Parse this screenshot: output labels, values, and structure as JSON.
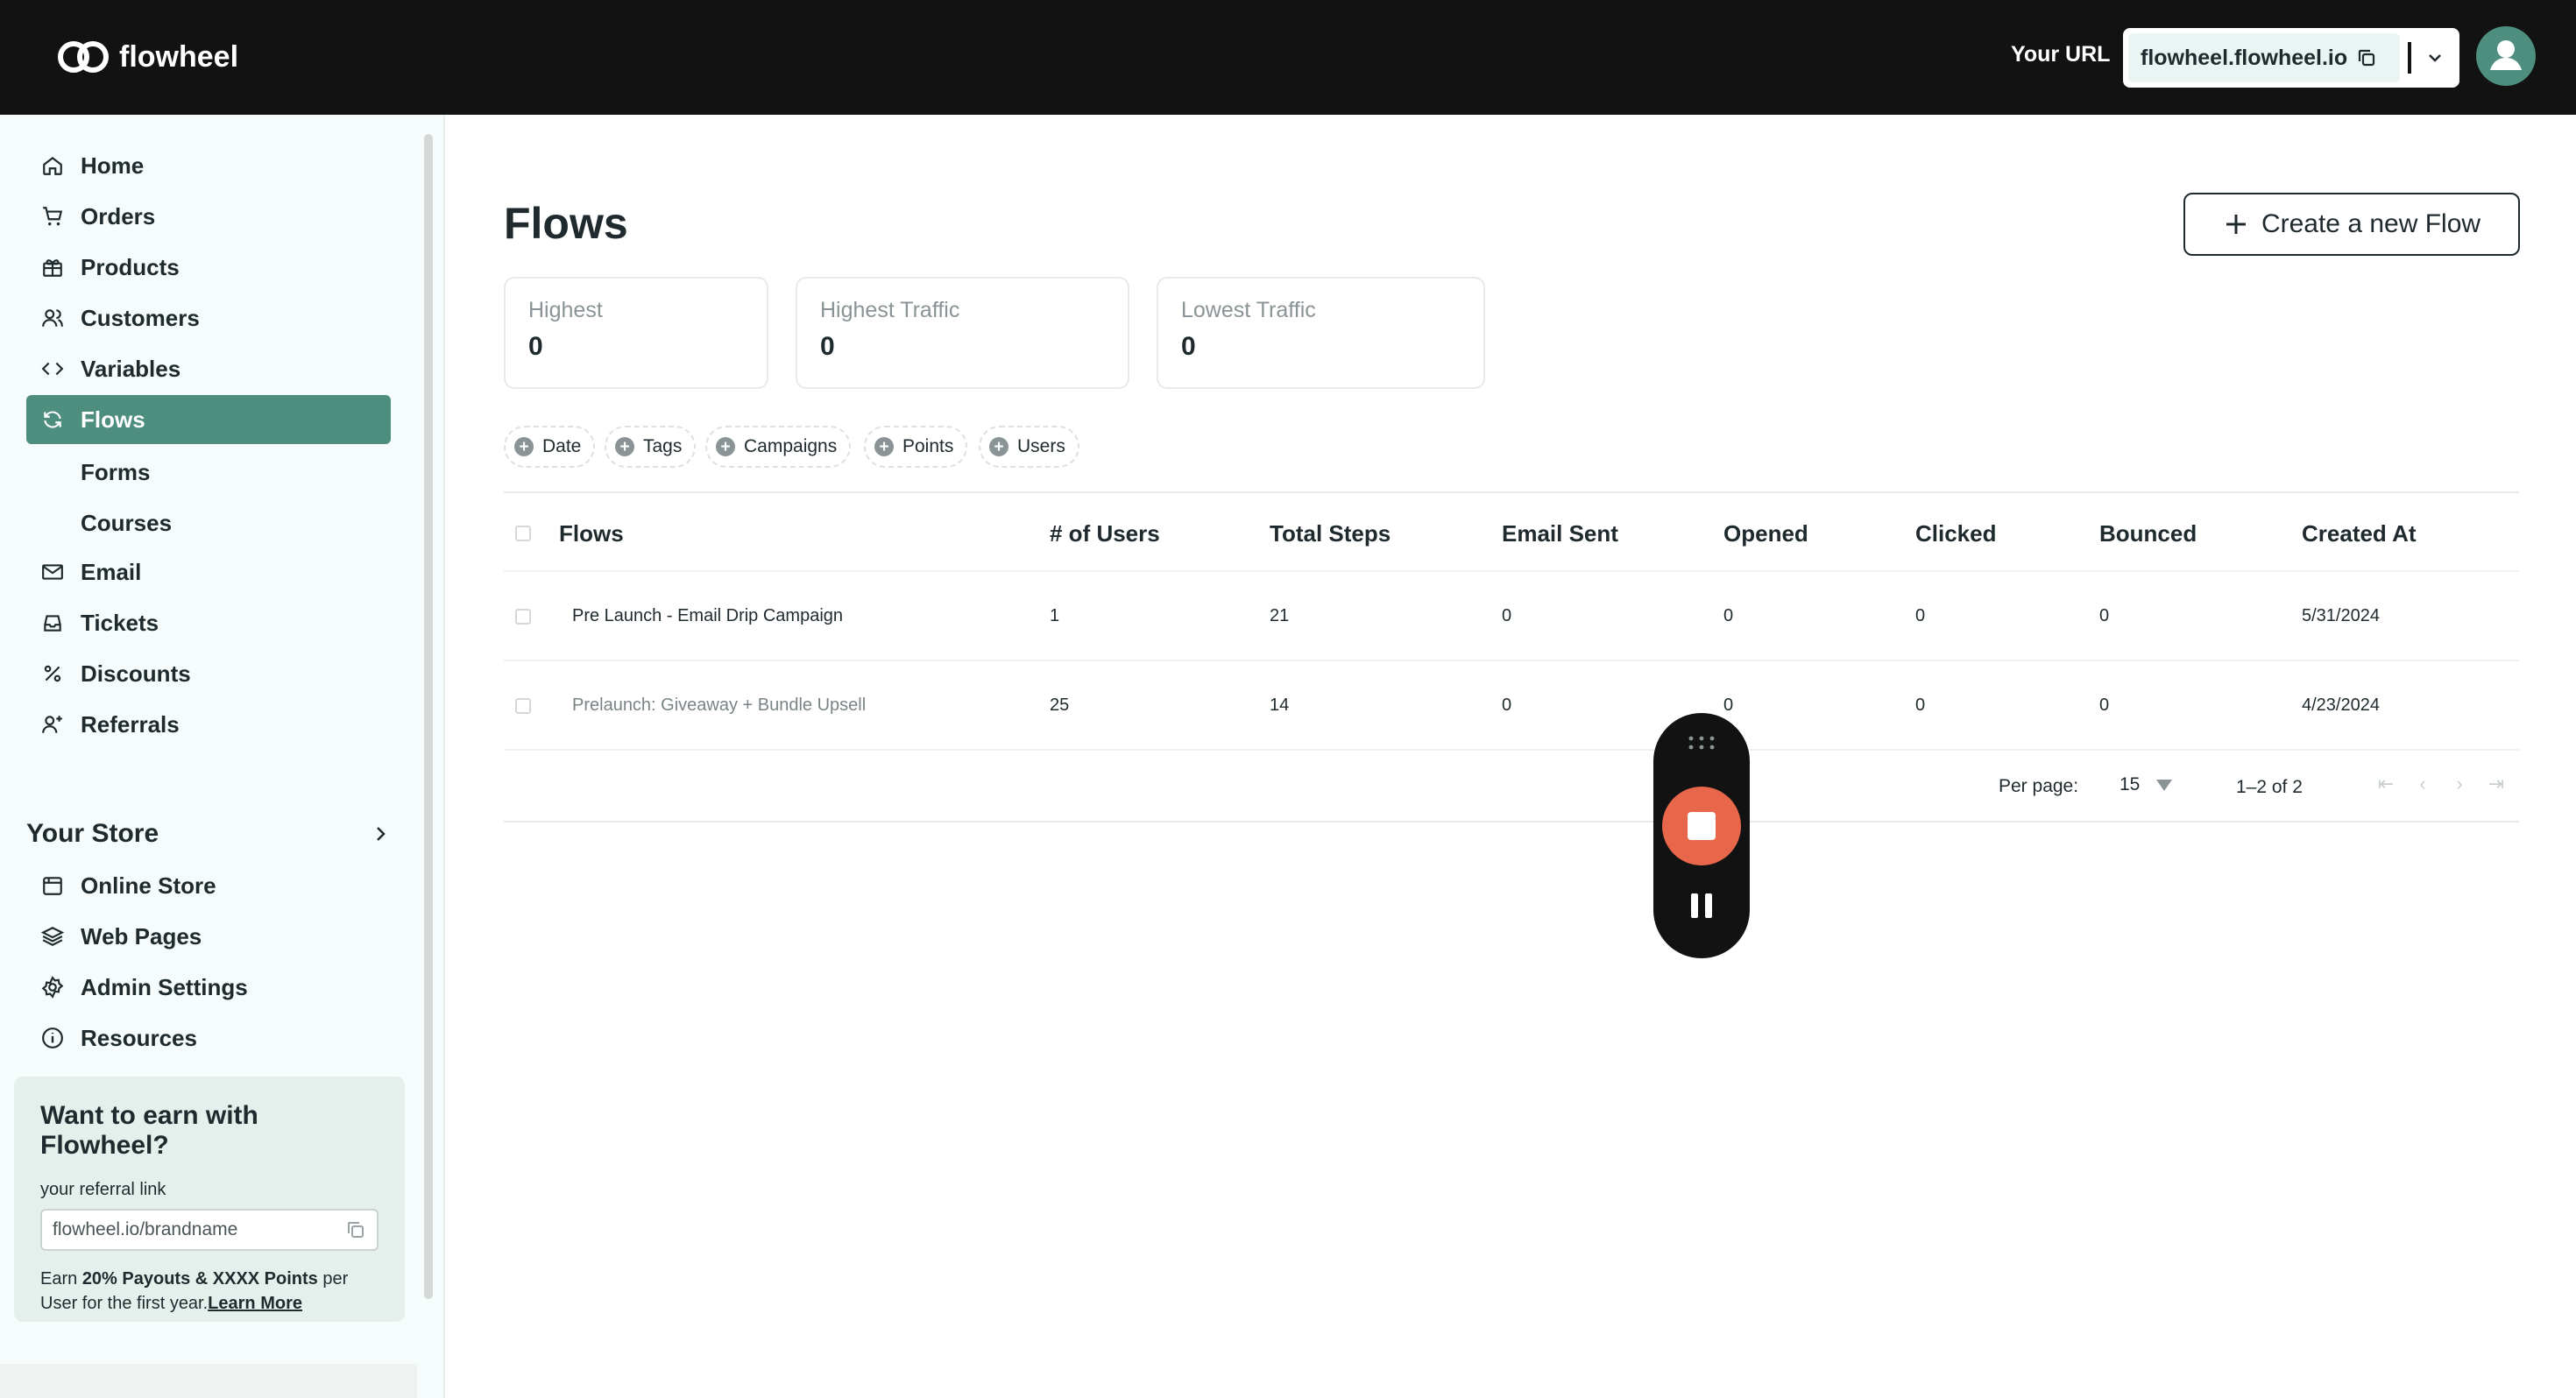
{
  "header": {
    "brand": "flowheel",
    "url_label": "Your URL",
    "url_value": "flowheel.flowheel.io"
  },
  "sidebar": {
    "items": [
      {
        "label": "Home",
        "icon": "home-icon"
      },
      {
        "label": "Orders",
        "icon": "cart-icon"
      },
      {
        "label": "Products",
        "icon": "gift-icon"
      },
      {
        "label": "Customers",
        "icon": "users-icon"
      },
      {
        "label": "Variables",
        "icon": "code-icon"
      },
      {
        "label": "Flows",
        "icon": "refresh-icon",
        "active": true
      },
      {
        "label": "Forms"
      },
      {
        "label": "Courses"
      },
      {
        "label": "Email",
        "icon": "mail-icon"
      },
      {
        "label": "Tickets",
        "icon": "inbox-icon"
      },
      {
        "label": "Discounts",
        "icon": "percent-icon"
      },
      {
        "label": "Referrals",
        "icon": "user-plus-icon"
      }
    ],
    "store": {
      "title": "Your Store",
      "items": [
        {
          "label": "Online Store",
          "icon": "store-icon"
        },
        {
          "label": "Web Pages",
          "icon": "layers-icon"
        },
        {
          "label": "Admin Settings",
          "icon": "settings-icon"
        },
        {
          "label": "Resources",
          "icon": "info-icon"
        }
      ]
    },
    "promo": {
      "title": "Want to earn with Flowheel?",
      "link_label": "your referral link",
      "link_value": "flowheel.io/brandname",
      "text_prefix": "Earn ",
      "text_bold": "20% Payouts & XXXX Points",
      "text_suffix": " per User for the first year.",
      "learn_more": "Learn More"
    }
  },
  "main": {
    "title": "Flows",
    "create_button": "Create a new Flow",
    "stats": [
      {
        "label": "Highest",
        "value": "0"
      },
      {
        "label": "Highest Traffic",
        "value": "0"
      },
      {
        "label": "Lowest Traffic",
        "value": "0"
      }
    ],
    "filters": [
      "Date",
      "Tags",
      "Campaigns",
      "Points",
      "Users"
    ],
    "table": {
      "headers": [
        "Flows",
        "# of Users",
        "Total Steps",
        "Email Sent",
        "Opened",
        "Clicked",
        "Bounced",
        "Created At"
      ],
      "rows": [
        [
          "Pre Launch - Email Drip Campaign",
          "1",
          "21",
          "0",
          "0",
          "0",
          "0",
          "5/31/2024"
        ],
        [
          "Prelaunch: Giveaway + Bundle Upsell",
          "25",
          "14",
          "0",
          "0",
          "0",
          "0",
          "4/23/2024"
        ]
      ]
    },
    "pager": {
      "per_page_label": "Per page:",
      "per_page_value": "15",
      "range": "1–2 of 2"
    }
  },
  "colors": {
    "accent": "#4e8e7e",
    "topbar": "#121212",
    "record": "#e8664a"
  }
}
